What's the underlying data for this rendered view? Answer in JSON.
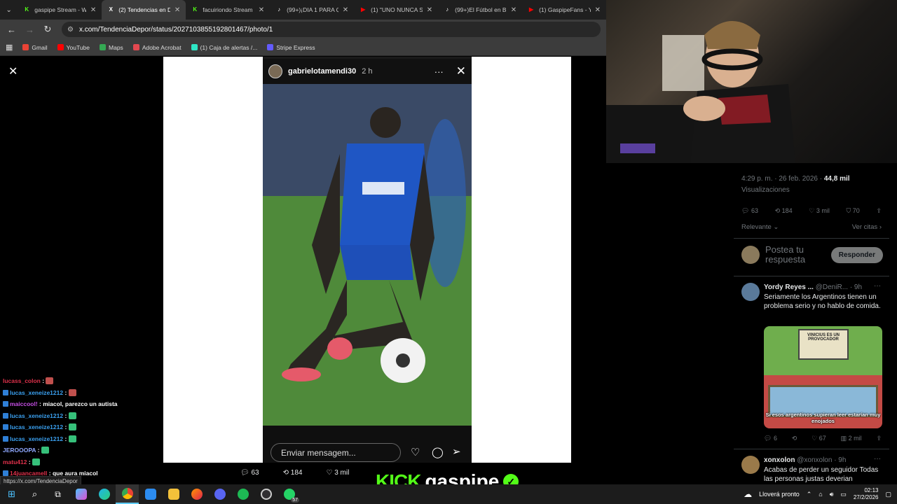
{
  "tabs": [
    {
      "label": "gaspipe Stream - Wa",
      "fav": "K",
      "fav_color": "#53fc18",
      "active": false
    },
    {
      "label": "(2) Tendencias en De",
      "fav": "X",
      "fav_color": "#ffffff",
      "active": true
    },
    {
      "label": "facuiriondo Stream -",
      "fav": "K",
      "fav_color": "#53fc18",
      "active": false
    },
    {
      "label": "(99+)¡DIA 1 PARA QU",
      "fav": "♪",
      "fav_color": "#ffffff",
      "active": false
    },
    {
      "label": "(1) \"UNO NUNCA SE",
      "fav": "▶",
      "fav_color": "#ff0000",
      "active": false
    },
    {
      "label": "(99+)El Fútbol en Bra",
      "fav": "♪",
      "fav_color": "#ffffff",
      "active": false
    },
    {
      "label": "(1) GaspipeFans - You",
      "fav": "▶",
      "fav_color": "#ff0000",
      "active": false
    }
  ],
  "address": "x.com/TendenciaDepor/status/2027103855192801467/photo/1",
  "bookmarks": [
    {
      "label": "Gmail",
      "color": "#ea4335"
    },
    {
      "label": "YouTube",
      "color": "#ff0000"
    },
    {
      "label": "Maps",
      "color": "#34a853"
    },
    {
      "label": "Adobe Acrobat",
      "color": "#e34850"
    },
    {
      "label": "(1) Caja de alertas /...",
      "color": "#2ee6c5"
    },
    {
      "label": "Stripe Express",
      "color": "#635bff"
    }
  ],
  "story": {
    "username": "gabrielotamendi30",
    "age": "2 h",
    "message_placeholder": "Enviar mensagem..."
  },
  "tweet": {
    "time": "4:29 p. m. · 26 feb. 2026 · ",
    "views_count": "44,8 mil",
    "views_label": "Visualizaciones",
    "replies": "63",
    "retweets": "184",
    "likes": "3 mil",
    "bookmarks": "70",
    "sort": "Relevante",
    "quotes": "Ver citas",
    "reply_placeholder": "Postea tu respuesta",
    "reply_button": "Responder"
  },
  "replies": [
    {
      "name": "Yordy Reyes ...",
      "handle": "@DeniR...",
      "time": "· 9h",
      "text": "Seriamente los Argentinos tienen un problema serio y no hablo de comida.",
      "meme_top": "VINICIUS ES UN PROVOCADOR",
      "meme_caption": "Si esos argentinos supieran leer estarían muy enojados",
      "replies": "6",
      "likes": "67",
      "views": "2 mil"
    },
    {
      "name": "xonxolon",
      "handle": "@xonxolon",
      "time": "· 9h",
      "text": "Acabas de perder un seguidor Todas las personas justas deverian"
    }
  ],
  "bottom_bar": {
    "replies": "63",
    "retweets": "184",
    "likes": "3 mil"
  },
  "status_url": "https://x.com/TendenciaDepor",
  "chat": [
    {
      "user": "lucass_colon",
      "color": "#e0314b",
      "msg": "",
      "badge": false,
      "emote": "#c0504d"
    },
    {
      "user": "lucas_xeneize1212",
      "color": "#3aa0f0",
      "msg": "",
      "badge": true,
      "emote": "#c0504d"
    },
    {
      "user": "maiccool!",
      "color": "#c64fe6",
      "msg": "miacol, parezco un autista",
      "badge": true,
      "emote": ""
    },
    {
      "user": "lucas_xeneize1212",
      "color": "#3aa0f0",
      "msg": "",
      "badge": true,
      "emote": "#36c07a"
    },
    {
      "user": "lucas_xeneize1212",
      "color": "#3aa0f0",
      "msg": "",
      "badge": true,
      "emote": "#36c07a"
    },
    {
      "user": "lucas_xeneize1212",
      "color": "#3aa0f0",
      "msg": "",
      "badge": true,
      "emote": "#36c07a"
    },
    {
      "user": "JEROOOPA",
      "color": "#8fa8ff",
      "msg": "",
      "badge": false,
      "emote": "#36c07a"
    },
    {
      "user": "matu412",
      "color": "#e0314b",
      "msg": "",
      "badge": false,
      "emote": "#36c07a"
    },
    {
      "user": "14juancamell",
      "color": "#e0314b",
      "msg": "que aura miacol",
      "badge": true,
      "emote": ""
    }
  ],
  "kick": {
    "brand": "KICK",
    "channel": "gaspipe"
  },
  "taskbar": {
    "weather": "Lloverá pronto",
    "time": "02:13",
    "date": "27/2/2026",
    "whatsapp_badge": "57"
  },
  "colors": {
    "accent_green": "#53fc18",
    "twitter_bg": "#000000",
    "chrome_bg": "#3c3c3c"
  }
}
